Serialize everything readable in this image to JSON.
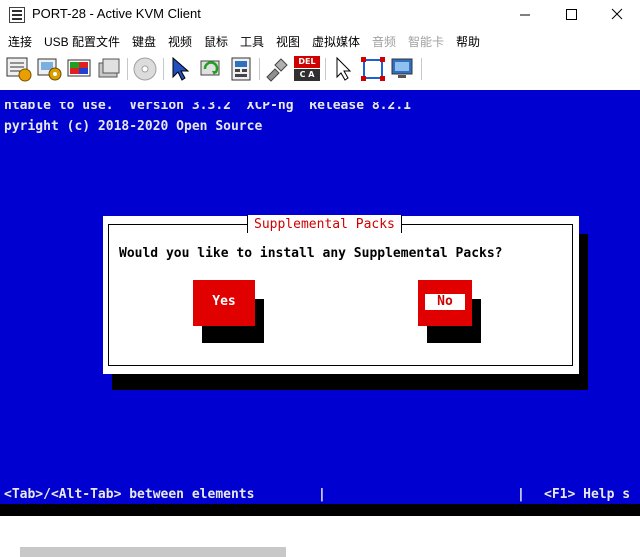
{
  "window": {
    "title": "PORT-28 - Active KVM Client"
  },
  "menu": [
    "连接",
    "USB 配置文件",
    "键盘",
    "视频",
    "鼠标",
    "工具",
    "视图",
    "虚拟媒体",
    "音频",
    "智能卡",
    "帮助"
  ],
  "menu_disabled": [
    "音频",
    "智能卡"
  ],
  "toolbar_icons": [
    "connection-properties-icon",
    "usb-settings-icon",
    "video-settings-icon",
    "session-icon",
    "cd-media-icon",
    "cursor-icon",
    "refresh-icon",
    "keyboard-icon",
    "plug-icon",
    "ctrl-alt-del-icon",
    "pointer-icon",
    "fullscreen-icon",
    "screenshot-icon"
  ],
  "toolbar_badge": {
    "del": "DEL",
    "ca": "C A"
  },
  "console": {
    "line1": "ntable to use.  Version 3.3.2  XCP-ng  Release 8.2.1",
    "line2": "pyright (c) 2018-2020 Open Source",
    "dialog_title": "Supplemental Packs",
    "dialog_question": "Would you like to install any Supplemental Packs?",
    "btn_yes": "Yes",
    "btn_no": "No",
    "status_left": "<Tab>/<Alt-Tab> between elements",
    "status_sep": "|",
    "status_right": "<F1> Help s"
  }
}
